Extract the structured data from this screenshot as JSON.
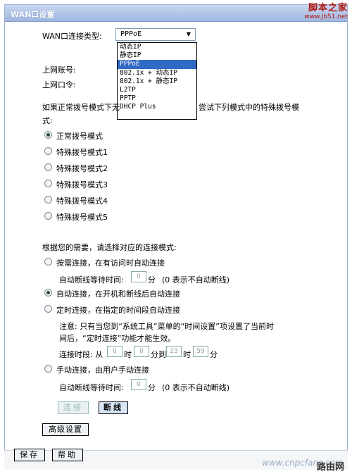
{
  "window": {
    "title": "WAN口设置"
  },
  "watermark_top": {
    "line1": "脚本之家",
    "line2": "www.Jb51.net"
  },
  "watermark_bottom": {
    "site": "www.cnpcfans.com",
    "logo": "路由网"
  },
  "wan_type": {
    "label": "WAN口连接类型:",
    "value": "PPPoE",
    "options": [
      "动态IP",
      "静态IP",
      "PPPoE",
      "802.1x + 动态IP",
      "802.1x + 静态IP",
      "L2TP",
      "PPTP",
      "DHCP Plus"
    ]
  },
  "account": {
    "username_label": "上网账号:",
    "password_label": "上网口令:"
  },
  "dial_mode": {
    "intro_line1_left": "如果正常拨号模式下无",
    "intro_line1_right": "尝试下列模式中的特殊拨号模",
    "intro_line2": "式:",
    "options": [
      "正常拨号模式",
      "特殊拨号模式1",
      "特殊拨号模式2",
      "特殊拨号模式3",
      "特殊拨号模式4",
      "特殊拨号模式5"
    ]
  },
  "connect_mode": {
    "intro": "根据您的需要，请选择对应的连接模式:",
    "on_demand": "按需连接，在有访问时自动连接",
    "auto": "自动连接，在开机和断线后自动连接",
    "timed": "定时连接，在指定的时间段自动连接",
    "manual": "手动连接，由用户手动连接",
    "idle_label": "自动断线等待时间:",
    "idle_value": "0",
    "idle_unit": "分",
    "idle_hint": "(0 表示不自动断线)",
    "manual_idle_value": "0",
    "note_line1": "注意: 只有当您到“系统工具”菜单的“时间设置”项设置了当前时",
    "note_line2": "间后，“定时连接”功能才能生效。",
    "period_label": "连接时段: 从",
    "from_hour": "0",
    "hour_unit": "时",
    "from_min": "0",
    "to_label": "分到",
    "to_hour": "23",
    "to_min": "59",
    "min_unit": "分"
  },
  "buttons": {
    "connect": "连接",
    "disconnect": "断线",
    "advanced": "高级设置",
    "save": "保存",
    "help": "帮助"
  }
}
